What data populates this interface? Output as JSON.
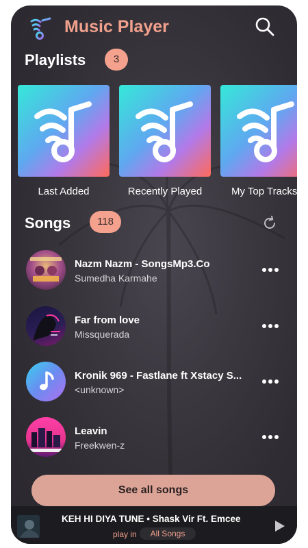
{
  "app": {
    "title": "Music Player"
  },
  "playlists": {
    "title": "Playlists",
    "count": "3",
    "items": [
      {
        "label": "Last Added"
      },
      {
        "label": "Recently Played"
      },
      {
        "label": "My Top Tracks"
      }
    ]
  },
  "songs": {
    "title": "Songs",
    "count": "118",
    "items": [
      {
        "title": "Nazm Nazm - SongsMp3.Co",
        "artist": "Sumedha Karmahe",
        "art": "album-cover-icon"
      },
      {
        "title": "Far from love",
        "artist": "Missquerada",
        "art": "album-cover-icon"
      },
      {
        "title": "Kronik 969 - Fastlane ft Xstacy S...",
        "artist": "<unknown>",
        "art": "music-note-icon"
      },
      {
        "title": "Leavin",
        "artist": "Freekwen-z",
        "art": "album-cover-icon"
      }
    ],
    "see_all": "See all songs"
  },
  "mini_player": {
    "now_playing": "KEH HI DIYA TUNE  • Shask Vir Ft. Emcee",
    "play_in": "play in",
    "source": "All Songs"
  },
  "colors": {
    "accent": "#f0a08c",
    "badge": "#f4a28e",
    "see_all_button": "#dba497",
    "background": "#3a373d"
  }
}
